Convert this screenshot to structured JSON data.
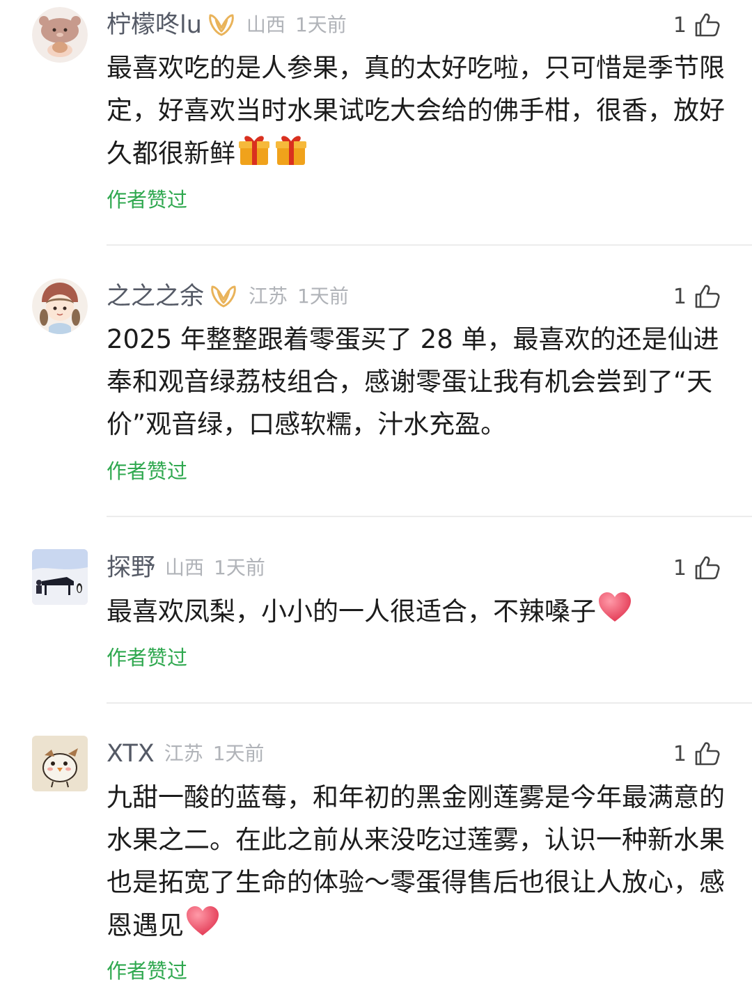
{
  "comments": [
    {
      "username": "柠檬咚lu",
      "vip": true,
      "location": "山西",
      "time": "1天前",
      "likes": "1",
      "text": "最喜欢吃的是人参果，真的太好吃啦，只可惜是季节限定，好喜欢当时水果试吃大会给的佛手柑，很香，放好久都很新鲜",
      "emojis": [
        "gift-emoji",
        "gift-emoji"
      ],
      "author_liked": "作者赞过"
    },
    {
      "username": "之之之余",
      "vip": true,
      "location": "江苏",
      "time": "1天前",
      "likes": "1",
      "text": "2025 年整整跟着零蛋买了 28 单，最喜欢的还是仙进奉和观音绿荔枝组合，感谢零蛋让我有机会尝到了“天价”观音绿，口感软糯，汁水充盈。",
      "emojis": [],
      "author_liked": "作者赞过"
    },
    {
      "username": "探野",
      "vip": false,
      "location": "山西",
      "time": "1天前",
      "likes": "1",
      "text": "最喜欢凤梨，小小的一人很适合，不辣嗓子",
      "emojis": [
        "heart-emoji"
      ],
      "author_liked": "作者赞过"
    },
    {
      "username": "XTX",
      "vip": false,
      "location": "江苏",
      "time": "1天前",
      "likes": "1",
      "text": "九甜一酸的蓝莓，和年初的黑金刚莲雾是今年最满意的水果之二。在此之前从来没吃过莲雾，认识一种新水果也是拓宽了生命的体验～零蛋得售后也很让人放心，感恩遇见",
      "emojis": [
        "heart-emoji"
      ],
      "author_liked": "作者赞过"
    }
  ],
  "colors": {
    "username": "#555a66",
    "meta": "#b0b3b8",
    "body": "#1c1c1c",
    "author_liked": "#2fa84f",
    "vip_badge": "#e9b35a",
    "divider": "#ececec"
  },
  "icons": {
    "like": "thumbs-up-outline-icon",
    "vip": "gold-vip-badge-icon"
  }
}
